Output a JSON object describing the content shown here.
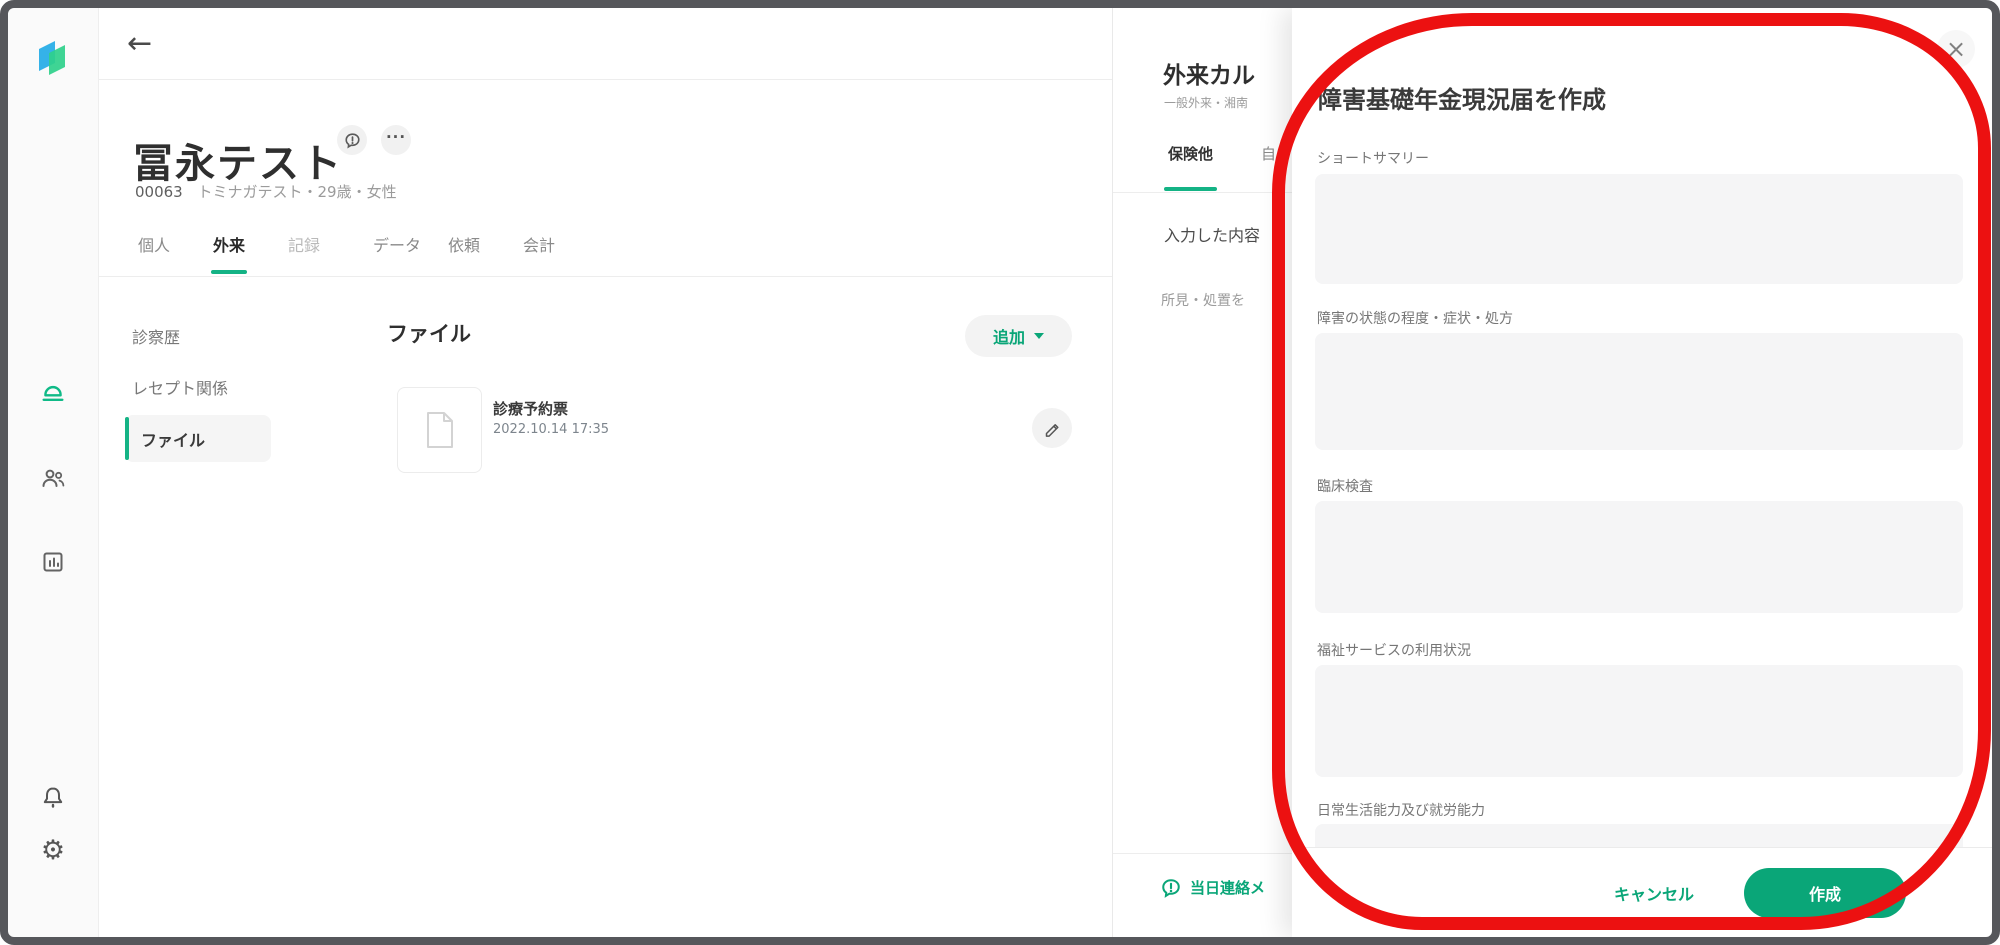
{
  "colors": {
    "accent": "#0aa678",
    "annotation_red": "#ec1111",
    "logo_blue": "#35b2e8",
    "logo_green": "#2fd08b"
  },
  "icons": {
    "back": "←",
    "more": "···",
    "close": "×"
  },
  "sidebar": {
    "items": [
      {
        "name": "reception",
        "active": true
      },
      {
        "name": "patients",
        "active": false
      },
      {
        "name": "stats",
        "active": false
      },
      {
        "name": "notifications",
        "active": false
      },
      {
        "name": "settings",
        "active": false
      }
    ]
  },
  "patient": {
    "name": "冨永テスト",
    "id": "00063",
    "summary": "トミナガテスト・29歳・女性",
    "tabs": [
      {
        "label": "個人",
        "active": false
      },
      {
        "label": "外来",
        "active": true
      },
      {
        "label": "記録",
        "active": false
      },
      {
        "label": "データ",
        "active": false
      },
      {
        "label": "依頼",
        "active": false
      },
      {
        "label": "会計",
        "active": false
      }
    ]
  },
  "subnav": {
    "items": [
      {
        "label": "診察歴",
        "selected": false
      },
      {
        "label": "レセプト関係",
        "selected": false
      },
      {
        "label": "ファイル",
        "selected": true
      }
    ]
  },
  "files": {
    "heading": "ファイル",
    "add_button_label": "追加",
    "items": [
      {
        "name": "診療予約票",
        "timestamp": "2022.10.14 17:35"
      }
    ]
  },
  "encounter": {
    "title": "外来カル",
    "subtitle": "一般外来・湘南",
    "tab_insurance": "保険他",
    "tab_partial": "自",
    "entered_label": "入力した内容",
    "hint_text": "所見・処置を",
    "contact_link": "当日連絡メ"
  },
  "modal": {
    "title": "障害基礎年金現況届を作成",
    "fields": [
      {
        "label": "ショートサマリー",
        "value": ""
      },
      {
        "label": "障害の状態の程度・症状・処方",
        "value": ""
      },
      {
        "label": "臨床検査",
        "value": ""
      },
      {
        "label": "福祉サービスの利用状況",
        "value": ""
      },
      {
        "label": "日常生活能力及び就労能力",
        "value": ""
      }
    ],
    "cancel_label": "キャンセル",
    "submit_label": "作成"
  }
}
